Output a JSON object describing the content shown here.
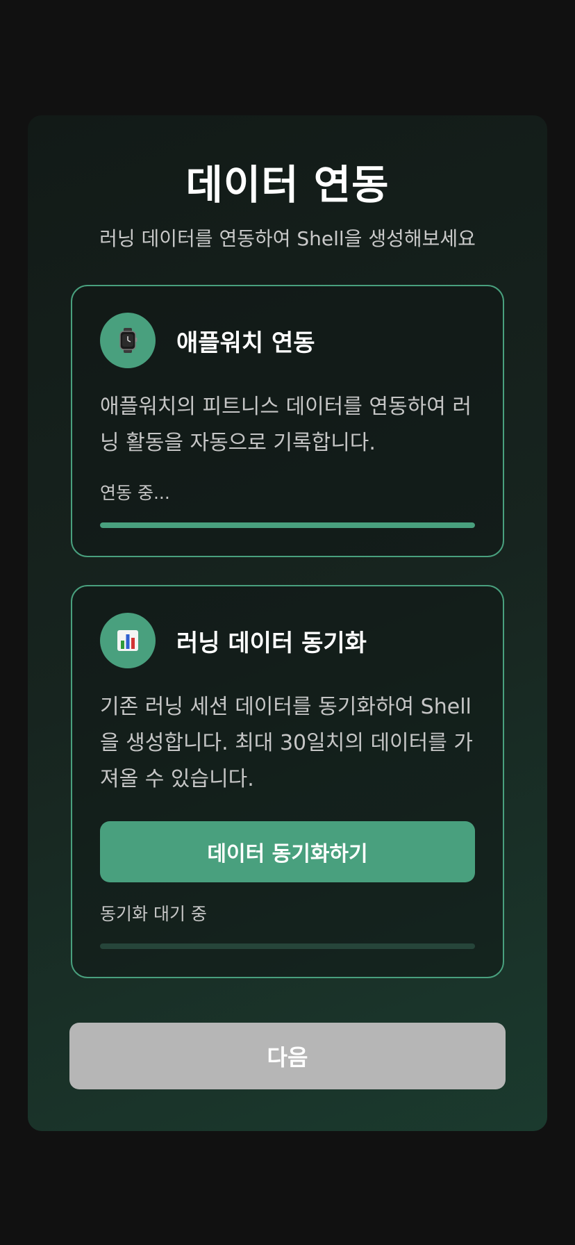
{
  "header": {
    "title": "데이터 연동",
    "subtitle": "러닝 데이터를 연동하여 Shell을 생성해보세요"
  },
  "cards": [
    {
      "icon": "watch-icon",
      "title": "애플워치 연동",
      "description": "애플워치의 피트니스 데이터를 연동하여 러닝 활동을 자동으로 기록합니다.",
      "status": "연동 중...",
      "progress": 1.0
    },
    {
      "icon": "bar-chart-icon",
      "title": "러닝 데이터 동기화",
      "description": "기존 러닝 세션 데이터를 동기화하여 Shell을 생성합니다. 최대 30일치의 데이터를 가져올 수 있습니다.",
      "button_label": "데이터 동기화하기",
      "status": "동기화 대기 중",
      "progress": 0.0
    }
  ],
  "footer": {
    "next_label": "다음"
  },
  "colors": {
    "accent": "#49a07e",
    "disabled": "#b6b6b6",
    "background": "#111111"
  }
}
